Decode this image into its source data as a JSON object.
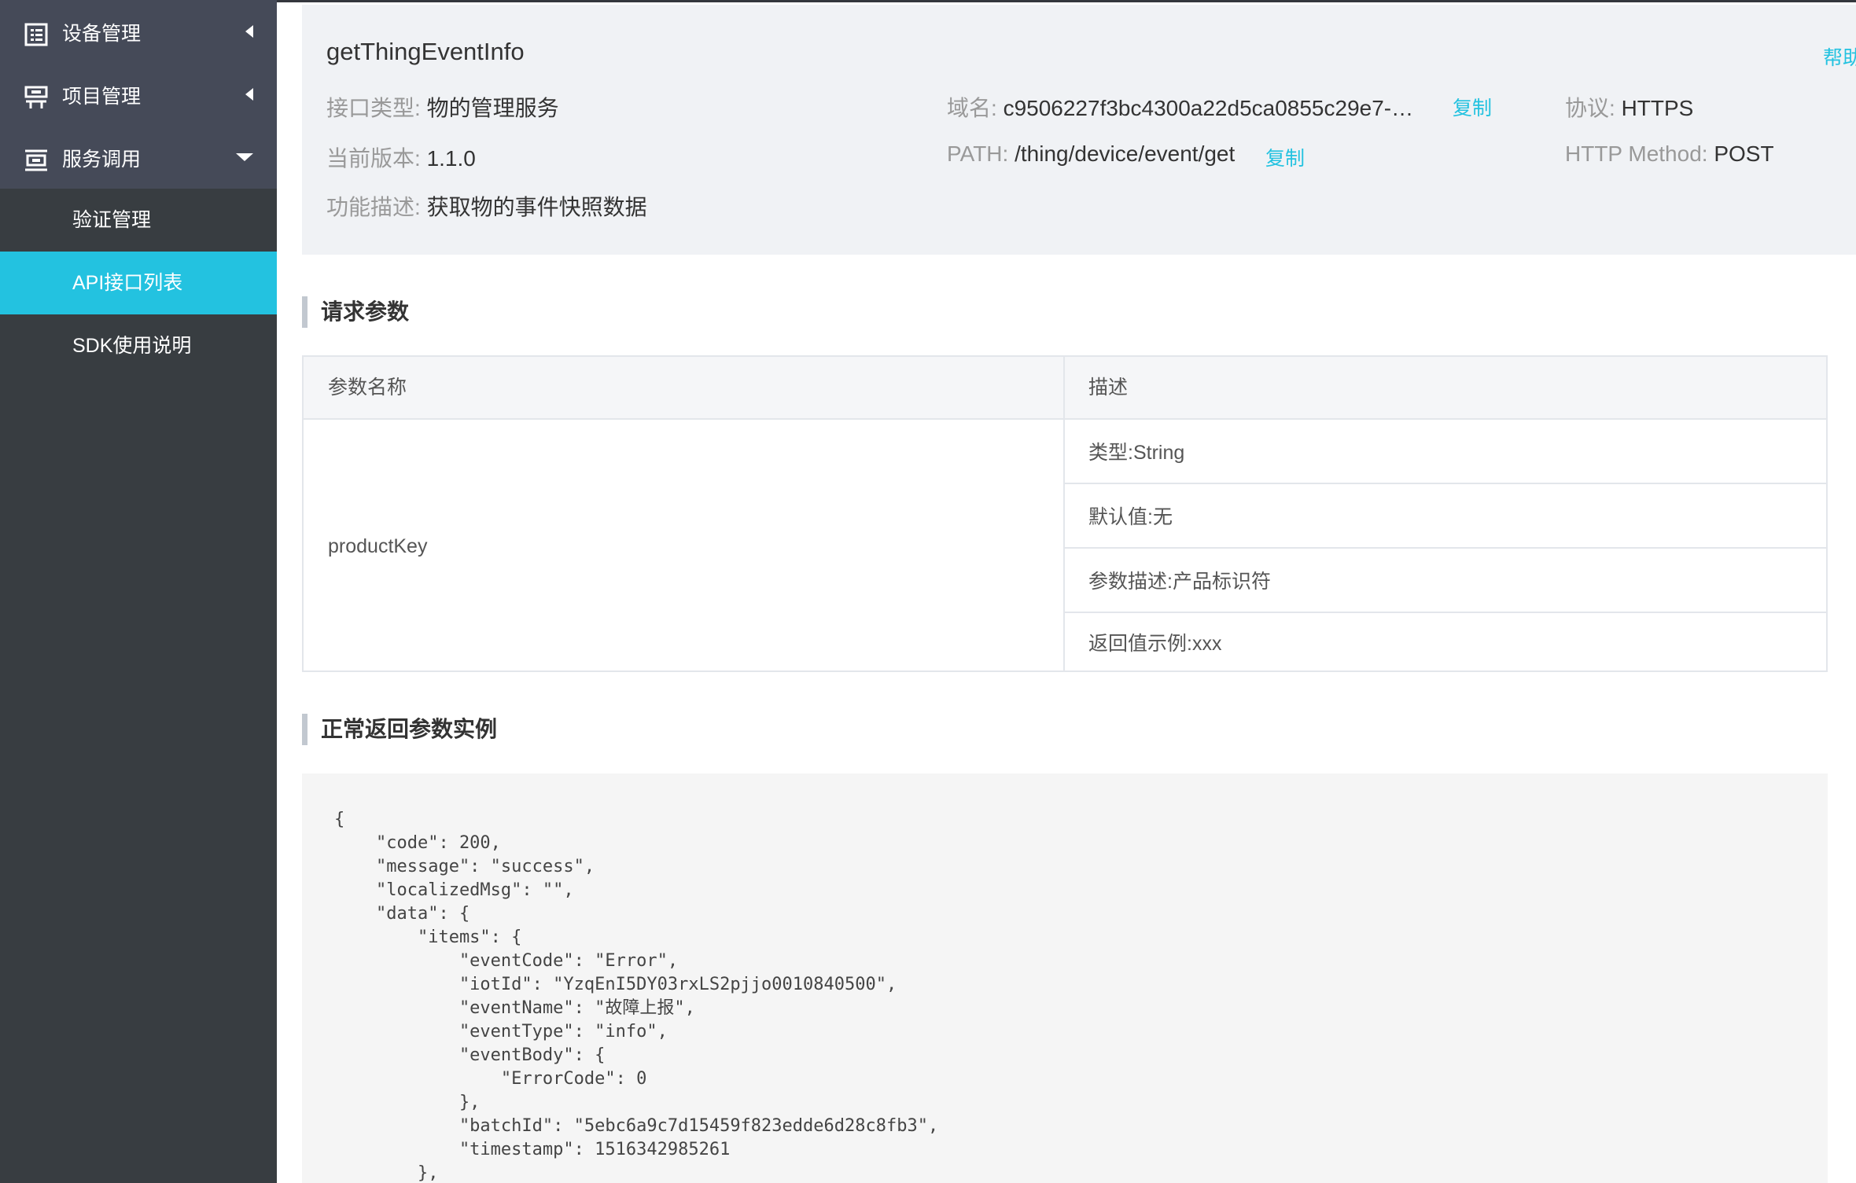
{
  "sidebar": {
    "groups": [
      {
        "label": "设备管理",
        "icon": "device-list-icon",
        "state": "collapsed"
      },
      {
        "label": "项目管理",
        "icon": "project-icon",
        "state": "collapsed"
      },
      {
        "label": "服务调用",
        "icon": "service-icon",
        "state": "expanded"
      }
    ],
    "sub_items": [
      {
        "label": "验证管理",
        "active": false
      },
      {
        "label": "API接口列表",
        "active": true
      },
      {
        "label": "SDK使用说明",
        "active": false
      }
    ],
    "colors": {
      "background": "#383d41",
      "group_background": "#454a58",
      "active": "#23c2e0"
    }
  },
  "api": {
    "name": "getThingEventInfo",
    "help_label": "帮助",
    "type_label": "接口类型:",
    "type_value": "物的管理服务",
    "domain_label": "域名:",
    "domain_value": "c9506227f3bc4300a22d5ca0855c29e7-…",
    "copy_label": "复制",
    "protocol_label": "协议:",
    "protocol_value": "HTTPS",
    "version_label": "当前版本:",
    "version_value": "1.1.0",
    "path_label": "PATH:",
    "path_value": "/thing/device/event/get",
    "method_label": "HTTP Method:",
    "method_value": "POST",
    "desc_label": "功能描述:",
    "desc_value": "获取物的事件快照数据"
  },
  "request_params": {
    "heading": "请求参数",
    "columns": [
      "参数名称",
      "描述"
    ],
    "rows": [
      {
        "name": "productKey",
        "details": [
          "类型:String",
          "默认值:无",
          "参数描述:产品标识符",
          "返回值示例:xxx"
        ]
      }
    ]
  },
  "response_example": {
    "heading": "正常返回参数实例",
    "code": "{\n    \"code\": 200,\n    \"message\": \"success\",\n    \"localizedMsg\": \"\",\n    \"data\": {\n        \"items\": {\n            \"eventCode\": \"Error\",\n            \"iotId\": \"YzqEnI5DY03rxLS2pjjo0010840500\",\n            \"eventName\": \"故障上报\",\n            \"eventType\": \"info\",\n            \"eventBody\": {\n                \"ErrorCode\": 0\n            },\n            \"batchId\": \"5ebc6a9c7d15459f823edde6d28c8fb3\",\n            \"timestamp\": 1516342985261\n        },"
  },
  "theme": {
    "accent": "#23c2e0",
    "panel_background": "#f0f2f5"
  }
}
